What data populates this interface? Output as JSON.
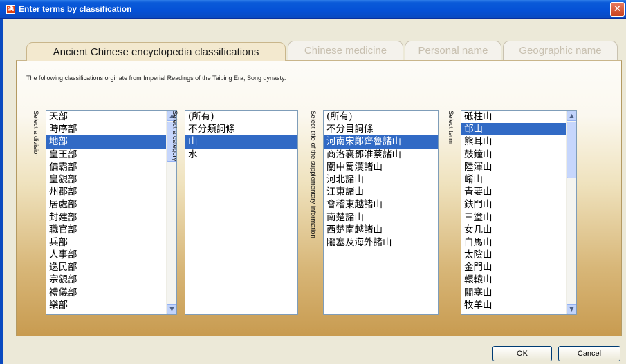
{
  "window": {
    "title": "Enter terms by classification",
    "app_icon": "漢",
    "close_glyph": "✕"
  },
  "tabs": [
    {
      "label": "Ancient Chinese encyclopedia classifications"
    },
    {
      "label": "Chinese medicine"
    },
    {
      "label": "Personal name"
    },
    {
      "label": "Geographic name"
    }
  ],
  "intro_text": "The following classifications orginate from Imperial Readings of the Taiping Era, Song dynasty.",
  "labels": {
    "division": "Select a division",
    "category": "Select a category",
    "supplementary": "Select title of the supplementary information",
    "term": "Select term"
  },
  "lists": {
    "division": [
      "天部",
      "時序部",
      "地部",
      "皇王部",
      "偏霸部",
      "皇親部",
      "州郡部",
      "居處部",
      "封建部",
      "職官部",
      "兵部",
      "人事部",
      "逸民部",
      "宗親部",
      "禮儀部",
      "樂部"
    ],
    "category": [
      "(所有)",
      "不分類詞條",
      "山",
      "水"
    ],
    "supplementary": [
      "(所有)",
      "不分目詞條",
      "河南宋鄭齊魯諸山",
      "商洛襄鄧淮蔡諸山",
      "關中蜀漢諸山",
      "河北諸山",
      "江東諸山",
      "會稽東越諸山",
      "南楚諸山",
      "西楚南越諸山",
      "隴塞及海外諸山"
    ],
    "term": [
      "砥柱山",
      "邙山",
      "熊耳山",
      "鼓鐘山",
      "陸渾山",
      "崤山",
      "青要山",
      "鈇門山",
      "三塗山",
      "女几山",
      "白馬山",
      "太陰山",
      "金門山",
      "轘轅山",
      "關塞山",
      "牧羊山"
    ]
  },
  "selected": {
    "division": "地部",
    "category": "山",
    "supplementary": "河南宋鄭齊魯諸山",
    "term": "邙山"
  },
  "buttons": {
    "ok": "OK",
    "cancel": "Cancel"
  },
  "colors": {
    "selection": "#316ac5",
    "titlebar": "#0551d6",
    "panel_bottom": "#c89b50"
  },
  "icons": {
    "scroll_up": "▲",
    "scroll_down": "▼"
  }
}
